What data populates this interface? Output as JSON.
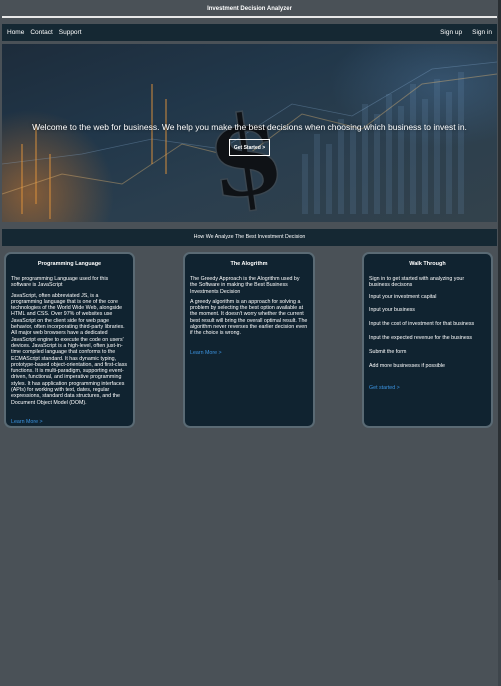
{
  "app": {
    "title": "Investment Decision Analyzer"
  },
  "nav": {
    "left": [
      "Home",
      "Contact",
      "Support"
    ],
    "right": [
      "Sign up",
      "Sign in"
    ]
  },
  "hero": {
    "headline": "Welcome to the web for business. We help you make the best decisions when choosing which business to invest in.",
    "cta": "Get Started >"
  },
  "section_title": "How We Analyze The Best Investment Decision",
  "cards": [
    {
      "title": "Programming Language",
      "paragraphs": [
        "The programming Language used for this software is JavaScript",
        "JavaScript, often abbreviated JS, is a programming language that is one of the core technologies of the World Wide Web, alongside HTML and CSS. Over 97% of websites use JavaScript on the client side for web page behavior, often incorporating third-party libraries. All major web browsers have a dedicated JavaScript engine to execute the code on users' devices. JavaScript is a high-level, often just-in-time compiled language that conforms to the ECMAScript standard. It has dynamic typing, prototype-based object-orientation, and first-class functions. It is multi-paradigm, supporting event-driven, functional, and imperative programming styles. It has application programming interfaces (APIs) for working with text, dates, regular expressions, standard data structures, and the Document Object Model (DOM)."
      ],
      "link": "Learn More >"
    },
    {
      "title": "The Alogrithm",
      "paragraphs": [
        "The Greedy Approach is the Alogrithm used by the Software in making the Best Business Investments Decision",
        "A greedy algorithm is an approach for solving a problem by selecting the best option available at the moment. It doesn't worry whether the current best result will bring the overall optimal result. The algorithm never reverses the earlier decision even if the choice is wrong."
      ],
      "link": "Learn More >"
    },
    {
      "title": "Walk Through",
      "intro": "Sign in to get started with analyzing your business decisons",
      "steps": [
        "Input your investment capital",
        "Input your business",
        "Input the cost of investment for that business",
        "Input the expected revenue for the business",
        "Submit the form",
        "Add more businesses if possible"
      ],
      "link": "Get started >"
    }
  ],
  "colors": {
    "page_bg": "#4a5157",
    "bar_bg": "#152833",
    "card_bg": "#102330",
    "link": "#3b93e0"
  },
  "icons": {
    "hero_symbol": "dollar-sign-icon"
  }
}
